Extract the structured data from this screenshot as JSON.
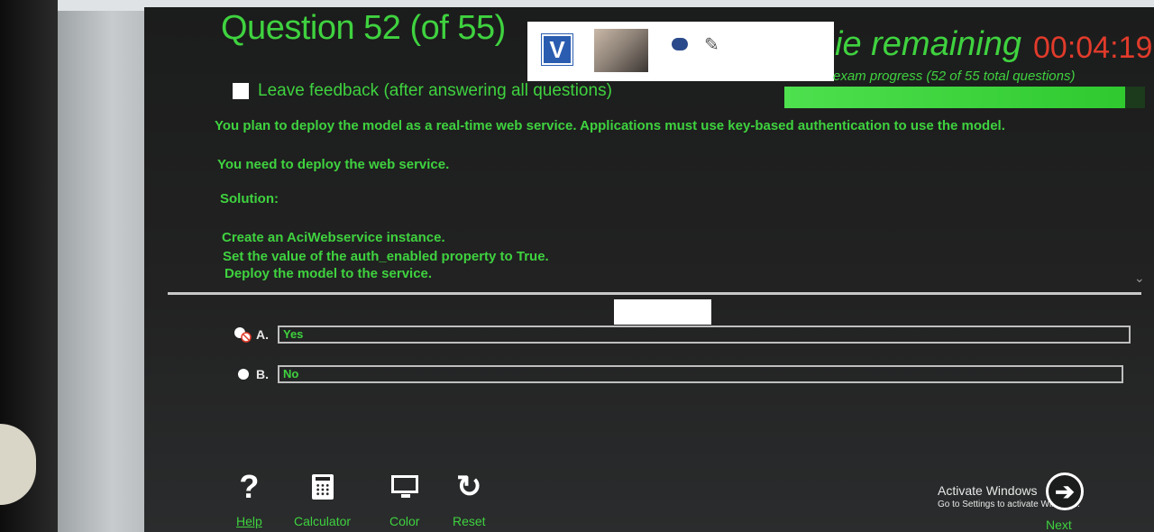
{
  "header": {
    "question_title": "Question 52 (of 55)",
    "time_label": "ie remaining",
    "time_value": "00:04:19",
    "progress_text": "exam progress (52 of 55 total questions)",
    "progress_fraction": 0.945
  },
  "overlay": {
    "logo_letter": "V",
    "icons": [
      "video-feed",
      "chat-icon",
      "edit-icon"
    ]
  },
  "feedback": {
    "label": "Leave feedback (after answering all questions)",
    "checked": false
  },
  "question": {
    "scenario": "You plan to deploy the model as a real-time web service. Applications must use key-based authentication to use the model.",
    "goal": "You need to deploy the web service.",
    "solution_label": "Solution:",
    "solution_steps": [
      "Create an AciWebservice instance.",
      "Set the value of the auth_enabled property to True.",
      "Deploy the model to the service."
    ]
  },
  "options": [
    {
      "letter": "A.",
      "text": "Yes",
      "selected": true
    },
    {
      "letter": "B.",
      "text": "No",
      "selected": false
    }
  ],
  "toolbar": {
    "help": "Help",
    "calculator": "Calculator",
    "color": "Color",
    "reset": "Reset"
  },
  "windows": {
    "activate_title": "Activate Windows",
    "activate_sub": "Go to Settings to activate Windows."
  },
  "navigation": {
    "next": "Next"
  },
  "colors": {
    "accent_green": "#3fd23f",
    "timer_red": "#e13b2b",
    "background": "#1b1c1c"
  }
}
